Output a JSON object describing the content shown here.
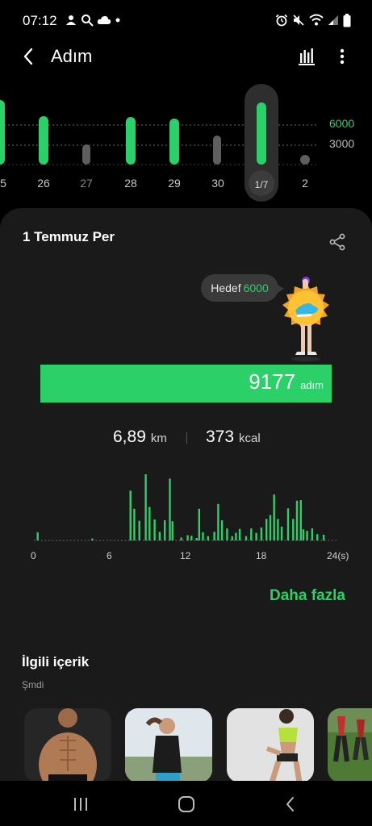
{
  "status_bar": {
    "time": "07:12",
    "left_icons": [
      "voice-assistant-icon",
      "search-icon",
      "cloud-icon",
      "dot-icon"
    ],
    "right_icons": [
      "alarm-icon",
      "mute-icon",
      "wifi-icon",
      "signal-icon",
      "battery-icon"
    ]
  },
  "app_bar": {
    "title": "Adım",
    "back_icon": "chevron-left-icon",
    "chart_icon": "bar-chart-icon",
    "more_icon": "more-vertical-icon"
  },
  "weekly": {
    "goal_lines": [
      "6000",
      "3000"
    ],
    "days": [
      {
        "label": "5",
        "met_goal": true
      },
      {
        "label": "26",
        "met_goal": true
      },
      {
        "label": "27",
        "met_goal": false
      },
      {
        "label": "28",
        "met_goal": true
      },
      {
        "label": "29",
        "met_goal": true
      },
      {
        "label": "30",
        "met_goal": false
      },
      {
        "label": "1/7",
        "met_goal": true,
        "selected": true
      },
      {
        "label": "2",
        "met_goal": false
      }
    ]
  },
  "day_card": {
    "date": "1 Temmuz Per",
    "share_icon": "share-icon",
    "target_label": "Hedef",
    "target_value": "6000",
    "steps": "9177",
    "steps_unit": "adım",
    "distance": "6,89",
    "distance_unit": "km",
    "calories": "373",
    "calories_unit": "kcal",
    "more_label": "Daha fazla"
  },
  "hourly_chart": {
    "x_labels": [
      "0",
      "6",
      "12",
      "18",
      "24(s)"
    ]
  },
  "related": {
    "title": "İlgili içerik",
    "subtitle": "Şmdi"
  },
  "nav_bar": {
    "recents_icon": "recents-icon",
    "home_icon": "home-icon",
    "back_icon": "back-icon"
  },
  "colors": {
    "accent": "#2bd068",
    "card_bg": "#1a1a1a",
    "page_bg": "#000000",
    "inactive_bar": "#5e5e5e"
  },
  "chart_data": {
    "type": "bar",
    "x_unit": "hour",
    "xlim": [
      0,
      24
    ],
    "x_ticks": [
      0,
      6,
      12,
      18,
      24
    ],
    "x_tick_labels": [
      "0",
      "6",
      "12",
      "18",
      "24(s)"
    ],
    "series": [
      {
        "values": [
          [
            0.3,
            85
          ],
          [
            4.6,
            20
          ],
          [
            7.6,
            520
          ],
          [
            7.9,
            330
          ],
          [
            8.3,
            205
          ],
          [
            8.8,
            690
          ],
          [
            9.1,
            350
          ],
          [
            9.5,
            220
          ],
          [
            9.9,
            90
          ],
          [
            10.3,
            210
          ],
          [
            10.7,
            645
          ],
          [
            10.9,
            200
          ],
          [
            11.6,
            30
          ],
          [
            12.1,
            55
          ],
          [
            12.4,
            50
          ],
          [
            12.8,
            25
          ],
          [
            13.0,
            330
          ],
          [
            13.3,
            85
          ],
          [
            13.7,
            45
          ],
          [
            14.2,
            90
          ],
          [
            14.5,
            380
          ],
          [
            14.8,
            210
          ],
          [
            15.2,
            125
          ],
          [
            15.6,
            45
          ],
          [
            15.9,
            80
          ],
          [
            16.2,
            120
          ],
          [
            16.7,
            45
          ],
          [
            17.1,
            125
          ],
          [
            17.5,
            80
          ],
          [
            17.9,
            135
          ],
          [
            18.3,
            225
          ],
          [
            18.6,
            265
          ],
          [
            18.9,
            480
          ],
          [
            19.2,
            225
          ],
          [
            19.5,
            145
          ],
          [
            20.0,
            335
          ],
          [
            20.4,
            225
          ],
          [
            20.7,
            415
          ],
          [
            21.0,
            420
          ],
          [
            21.2,
            115
          ],
          [
            21.5,
            100
          ],
          [
            21.9,
            125
          ],
          [
            22.3,
            65
          ],
          [
            22.8,
            60
          ]
        ]
      }
    ]
  }
}
